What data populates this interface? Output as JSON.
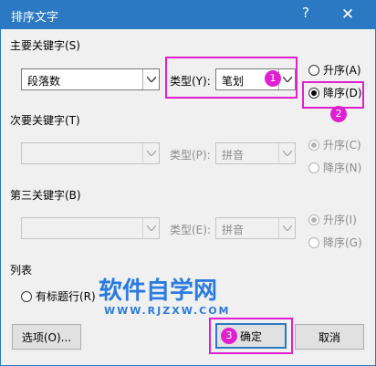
{
  "window": {
    "title": "排序文字",
    "help": "?",
    "close": "✕"
  },
  "primary": {
    "heading": "主要关键字(S)",
    "field": "段落数",
    "type_label": "类型(Y):",
    "type_value": "笔划",
    "ascending": "升序(A)",
    "descending": "降序(D)"
  },
  "secondary": {
    "heading": "次要关键字(T)",
    "field": "",
    "type_label": "类型(P):",
    "type_value": "拼音",
    "ascending": "升序(C)",
    "descending": "降序(N)"
  },
  "tertiary": {
    "heading": "第三关键字(B)",
    "field": "",
    "type_label": "类型(E):",
    "type_value": "拼音",
    "ascending": "升序(I)",
    "descending": "降序(G)"
  },
  "list": {
    "heading": "列表",
    "header_row": "有标题行(R)"
  },
  "buttons": {
    "options": "选项(O)...",
    "ok": "确定",
    "cancel": "取消"
  },
  "badges": {
    "one": "1",
    "two": "2",
    "three": "3"
  },
  "watermark": {
    "main": "软件自学网",
    "url": "WWW.RJZXW.COM"
  },
  "colors": {
    "titlebar": "#2b79c2",
    "highlight": "#e020d0",
    "watermark": "#2a7be0"
  }
}
